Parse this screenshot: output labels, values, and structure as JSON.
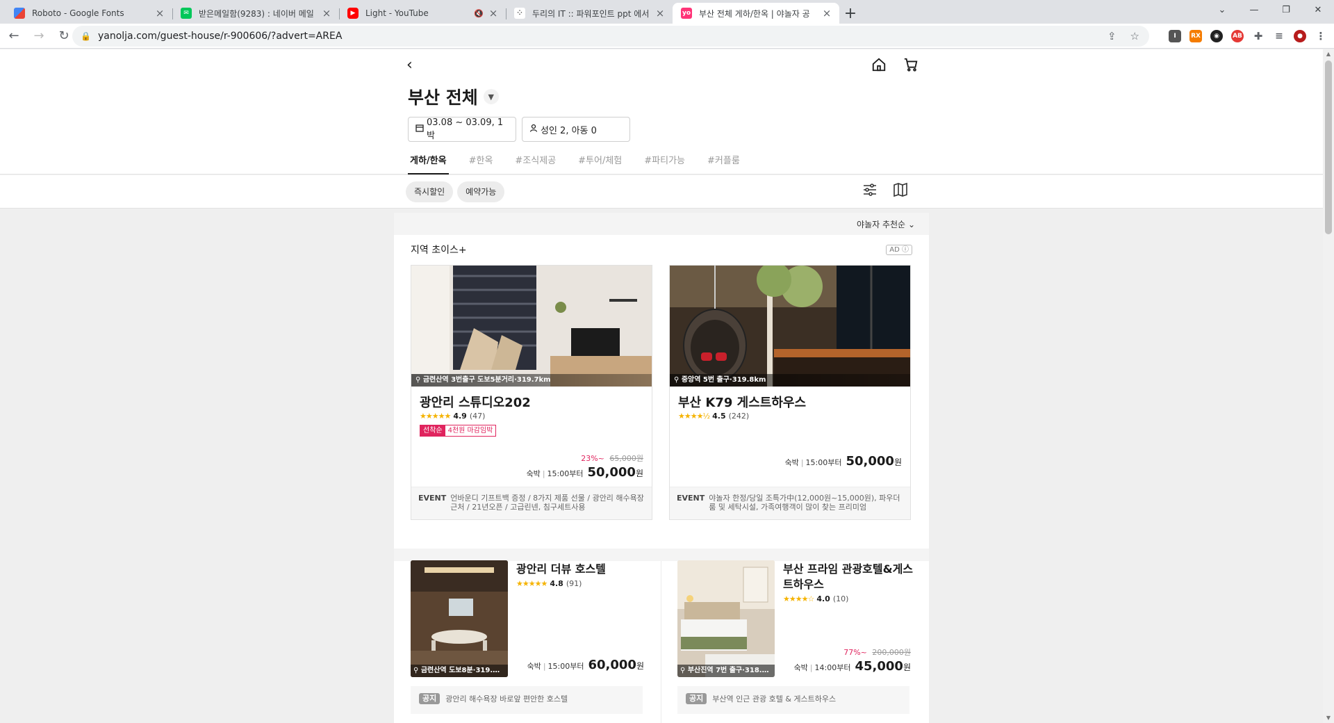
{
  "browser": {
    "tabs": [
      {
        "title": "Roboto - Google Fonts",
        "favicon_color": "#e37400",
        "active": false
      },
      {
        "title": "받은메일함(9283) : 네이버 메일",
        "favicon_color": "#03c75a",
        "active": false
      },
      {
        "title": "Light - YouTube",
        "favicon_color": "#ff0000",
        "active": false,
        "muted": true
      },
      {
        "title": "두리의 IT :: 파워포인트 ppt 에서",
        "favicon_color": "#333333",
        "active": false
      },
      {
        "title": "부산 전체 게하/한옥 | 야놀자 공",
        "favicon_color": "#ff3478",
        "favicon_text": "yo",
        "active": true
      }
    ],
    "url": "yanolja.com/guest-house/r-900606/?advert=AREA"
  },
  "header": {
    "region": "부산 전체",
    "date_filter": "03.08 ~ 03.09, 1박",
    "guest_filter": "성인 2, 아동 0",
    "tabs": [
      "게하/한옥",
      "#한옥",
      "#조식제공",
      "#투어/체험",
      "#파티가능",
      "#커플룸"
    ]
  },
  "chips": [
    "즉시할인",
    "예약가능"
  ],
  "sort_label": "야놀자 추천순",
  "section": {
    "title": "지역 초이스+",
    "ad": "AD"
  },
  "cards": [
    {
      "location": "금련산역 3번출구 도보5분거리·319.7km",
      "name": "광안리 스튜디오202",
      "rating": "4.9",
      "reviews": "(47)",
      "badge_a": "선착순",
      "badge_b": "4천원 마감임박",
      "discount": "23%~",
      "old_price": "65,000원",
      "stay_label": "숙박",
      "checkin": "15:00부터",
      "price": "50,000",
      "currency": "원",
      "event_label": "EVENT",
      "event_text": "언바운디 기프트백 증정 / 8가지 제품 선물 / 광안리 해수욕장 근처 / 21년오픈 / 고급린넨, 침구세트사용"
    },
    {
      "location": "중앙역 5번 출구·319.8km",
      "name": "부산 K79 게스트하우스",
      "rating": "4.5",
      "reviews": "(242)",
      "stay_label": "숙박",
      "checkin": "15:00부터",
      "price": "50,000",
      "currency": "원",
      "event_label": "EVENT",
      "event_text": "야놀자 한정/당일 조특가中(12,000원~15,000원), 파우더룸 및 세탁시설, 가족여행객이 많이 찾는 프리미엄"
    }
  ],
  "items": [
    {
      "location": "금련산역 도보8분·319.…",
      "name": "광안리 더뷰 호스텔",
      "rating": "4.8",
      "reviews": "(91)",
      "stay_label": "숙박",
      "checkin": "15:00부터",
      "price": "60,000",
      "currency": "원",
      "note_tag": "공지",
      "note": "광안리 해수욕장 바로앞 편안한 호스텔"
    },
    {
      "location": "부산진역 7번 출구·318.…",
      "name": "부산 프라임 관광호텔&게스트하우스",
      "rating": "4.0",
      "reviews": "(10)",
      "discount": "77%~",
      "old_price": "200,000원",
      "stay_label": "숙박",
      "checkin": "14:00부터",
      "price": "45,000",
      "currency": "원",
      "note_tag": "공지",
      "note": "부산역 인근 관광 호텔 & 게스트하우스"
    }
  ]
}
